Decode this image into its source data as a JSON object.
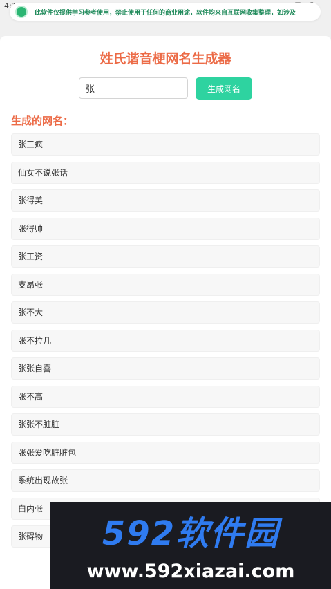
{
  "status": {
    "time": "4:13"
  },
  "notice": {
    "text": "此软件仅提供学习参考使用，禁止使用于任何的商业用途，软件均来自互联网收集整理，如涉及"
  },
  "app": {
    "title": "姓氏谐音梗网名生成器",
    "input_value": "张",
    "generate_button": "生成网名",
    "result_label": "生成的网名：",
    "results": [
      "张三疯",
      "仙女不说张话",
      "张得美",
      "张得帅",
      "张工资",
      "支昂张",
      "张不大",
      "张不拉几",
      "张张自喜",
      "张不高",
      "张张不脏脏",
      "张张爱吃脏脏包",
      "系统出现故张",
      "白内张",
      "张碍物"
    ]
  },
  "watermark": {
    "logo": "592软件园",
    "url": "www.592xiazai.com"
  },
  "colors": {
    "accent": "#ec6b47",
    "button": "#2ed3a0",
    "notice_text": "#1f8a5a",
    "watermark_bg": "#1a1b21",
    "watermark_logo": "#2f7bf0"
  }
}
